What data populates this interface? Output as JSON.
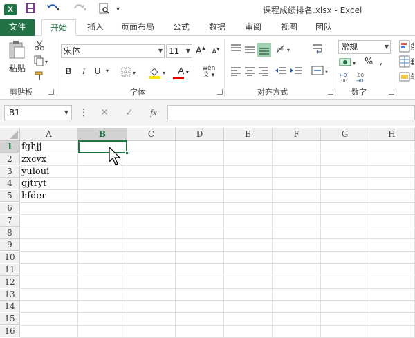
{
  "titlebar": {
    "app_icon": "X",
    "title": "课程成绩排名.xlsx - Excel"
  },
  "tabs": [
    "文件",
    "开始",
    "插入",
    "页面布局",
    "公式",
    "数据",
    "审阅",
    "视图",
    "团队"
  ],
  "ribbon": {
    "clipboard": {
      "paste_label": "粘贴",
      "group_label": "剪贴板"
    },
    "font": {
      "font_name": "宋体",
      "font_size": "11",
      "group_label": "字体",
      "bold": "B",
      "italic": "I",
      "underline": "U",
      "font_color_letter": "A",
      "phonetic": "wén"
    },
    "alignment": {
      "group_label": "对齐方式"
    },
    "number": {
      "format": "常规",
      "group_label": "数字",
      "percent": "%"
    }
  },
  "formula_bar": {
    "name_box": "B1",
    "cancel": "✕",
    "enter": "✓",
    "fx": "fx",
    "content": ""
  },
  "grid": {
    "columns": [
      "A",
      "B",
      "C",
      "D",
      "E",
      "F",
      "G",
      "H"
    ],
    "rows": [
      "1",
      "2",
      "3",
      "4",
      "5",
      "6",
      "7",
      "8",
      "9",
      "10",
      "11",
      "12",
      "13",
      "14",
      "15",
      "16"
    ],
    "selected_cell": "B1",
    "cells": {
      "A1": "fghjj",
      "A2": "zxcvx",
      "A3": "yuioui",
      "A4": "gjtryt",
      "A5": "hfder"
    }
  },
  "colors": {
    "accent": "#217346"
  }
}
